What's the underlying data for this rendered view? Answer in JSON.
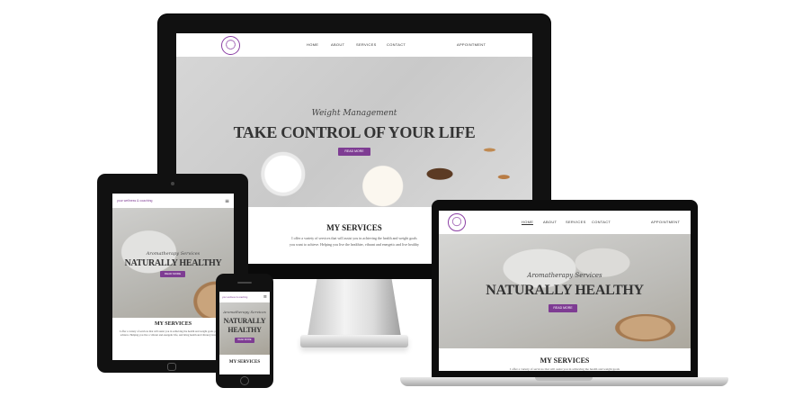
{
  "desktop": {
    "nav": [
      "HOME",
      "ABOUT",
      "SERVICES",
      "CONTACT"
    ],
    "nav_right": "APPOINTMENT",
    "hero_script": "Weight Management",
    "hero_title": "TAKE CONTROL OF YOUR LIFE",
    "hero_button": "READ MORE",
    "services_title": "MY SERVICES",
    "services_line1": "I offer a variety of services that will assist you in achieving the health and weight goals",
    "services_line2": "you want to achieve. Helping you live the healthier, vibrant and energetic and live healthy"
  },
  "tablet": {
    "brand": "your wellness & coaching",
    "menu_icon": "≡",
    "hero_script": "Aromatherapy Services",
    "hero_title": "NATURALLY HEALTHY",
    "hero_button": "READ MORE",
    "services_title": "MY SERVICES",
    "services_text": "I offer a variety of services that will assist you in achieving the health and weight goals you want to achieve. Helping you live a vibrant and energetic life, and bring health and vibrancy into your life"
  },
  "laptop": {
    "nav": [
      "HOME",
      "ABOUT",
      "SERVICES",
      "CONTACT"
    ],
    "nav_right": "APPOINTMENT",
    "hero_script": "Aromatherapy Services",
    "hero_title": "NATURALLY HEALTHY",
    "hero_button": "READ MORE",
    "services_title": "MY SERVICES",
    "services_text": "I offer a variety of services that will assist you in achieving the health and weight goals"
  },
  "phone": {
    "brand": "your wellness & coaching",
    "menu_icon": "≡",
    "hero_script": "Aromatherapy Services",
    "hero_title_1": "NATURALLY",
    "hero_title_2": "HEALTHY",
    "hero_button": "READ MORE",
    "services_title": "MY SERVICES"
  },
  "colors": {
    "accent": "#7e3c93",
    "text_dark": "#333333"
  },
  "icons": {
    "logo": "tree-of-life-logo",
    "menu": "hamburger-icon"
  }
}
